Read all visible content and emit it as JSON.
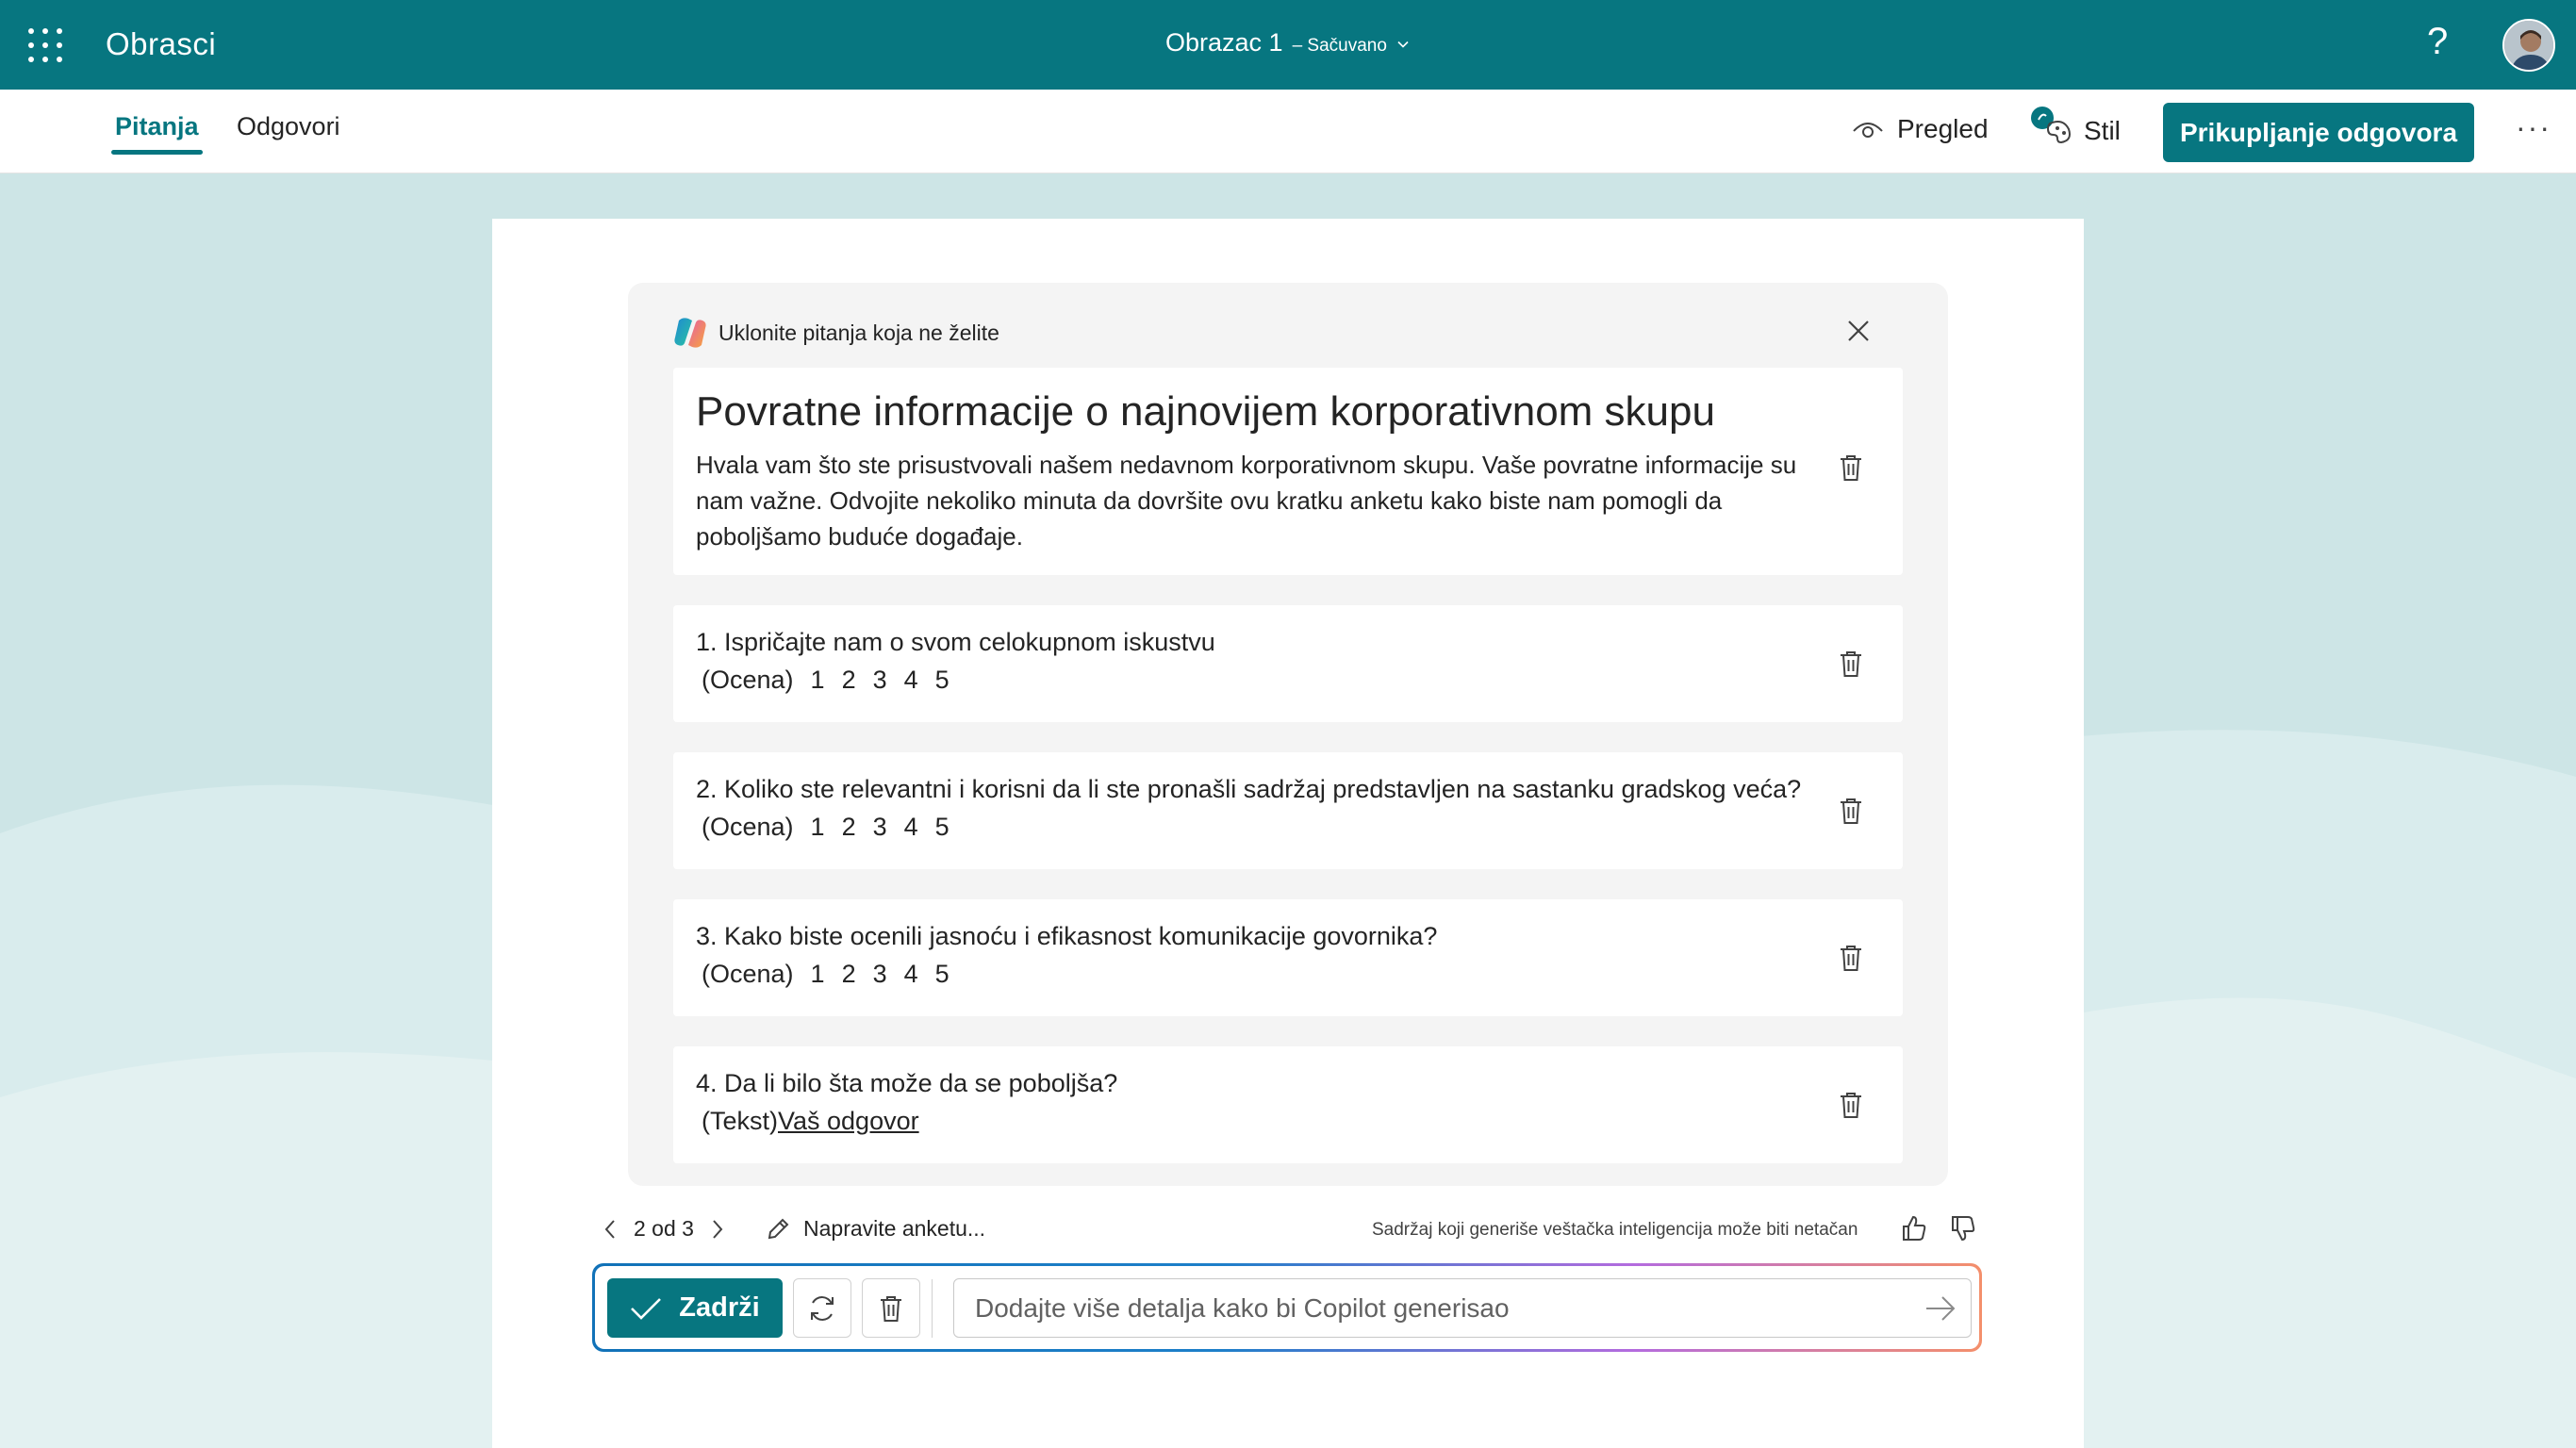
{
  "topbar": {
    "app_name": "Obrasci",
    "doc_title": "Obrazac 1",
    "saved_status": "– Sačuvano",
    "help": "?"
  },
  "tabs": {
    "questions": "Pitanja",
    "responses": "Odgovori"
  },
  "toolbar": {
    "preview": "Pregled",
    "style": "Stil",
    "collect": "Prikupljanje odgovora",
    "more": "···"
  },
  "copilot": {
    "header": "Uklonite pitanja koja ne želite",
    "form_title": "Povratne informacije o najnovijem korporativnom skupu",
    "form_description": "Hvala vam što ste prisustvovali našem nedavnom korporativnom skupu. Vaše povratne informacije su nam važne. Odvojite nekoliko minuta da dovršite ovu kratku anketu kako biste nam pomogli da poboljšamo buduće događaje.",
    "questions": [
      {
        "text": "1. Ispričajte nam o svom celokupnom iskustvu",
        "kind": "(Ocena)",
        "options": [
          "1",
          "2",
          "3",
          "4",
          "5"
        ]
      },
      {
        "text": "2. Koliko ste relevantni i korisni da li ste pronašli sadržaj predstavljen na sastanku gradskog veća?",
        "kind": "(Ocena)",
        "options": [
          "1",
          "2",
          "3",
          "4",
          "5"
        ]
      },
      {
        "text": "3. Kako biste ocenili jasnoću i efikasnost komunikacije govornika?",
        "kind": "(Ocena)",
        "options": [
          "1",
          "2",
          "3",
          "4",
          "5"
        ]
      },
      {
        "text": "4. Da li bilo šta može da se poboljša?",
        "kind": "(Tekst)",
        "placeholder_link": "Vaš odgovor"
      }
    ],
    "pager": "2 od 3",
    "generate_link": "Napravite anketu...",
    "disclaimer": "Sadržaj koji generiše veštačka inteligencija može biti netačan",
    "keep": "Zadrži",
    "prompt_placeholder": "Dodajte više detalja kako bi Copilot generisao"
  },
  "colors": {
    "brand": "#077680",
    "background": "#cfe6e7"
  }
}
